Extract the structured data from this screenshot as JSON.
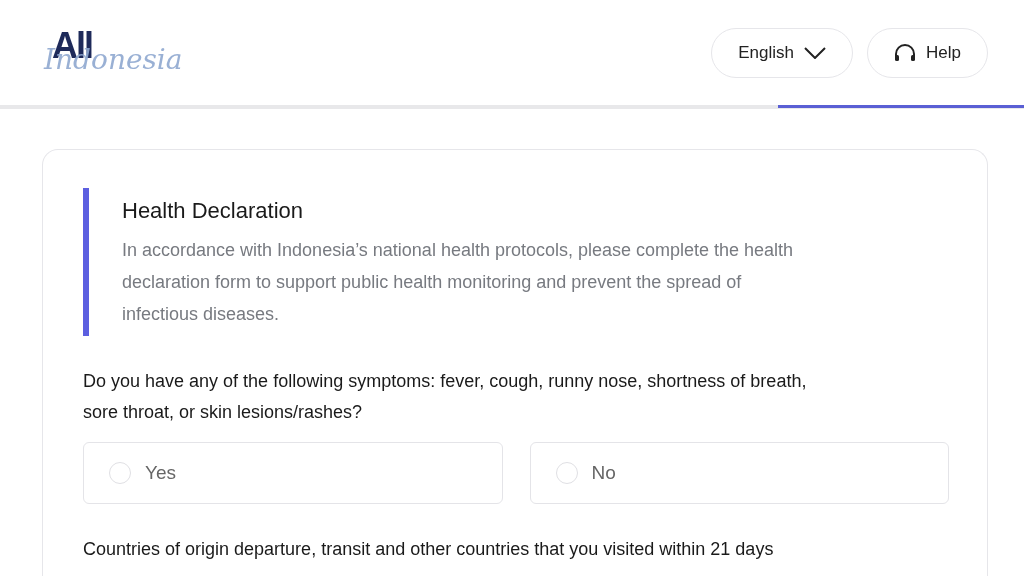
{
  "logo": {
    "main": "All",
    "script": "Indonesia"
  },
  "header": {
    "language": "English",
    "help": "Help"
  },
  "progress": {
    "level": 0.24
  },
  "section": {
    "title": "Health Declaration",
    "description": "In accordance with Indonesia’s national health protocols, please complete the health declaration form to support public health monitoring and prevent the spread of infectious diseases."
  },
  "questions": [
    {
      "text": "Do you have any of the following symptoms: fever, cough, runny nose, shortness of breath, sore throat, or skin lesions/rashes?",
      "options": [
        {
          "label": "Yes",
          "selected": false
        },
        {
          "label": "No",
          "selected": false
        }
      ]
    },
    {
      "text": "Countries of origin departure, transit and other countries that you visited within 21 days"
    }
  ]
}
